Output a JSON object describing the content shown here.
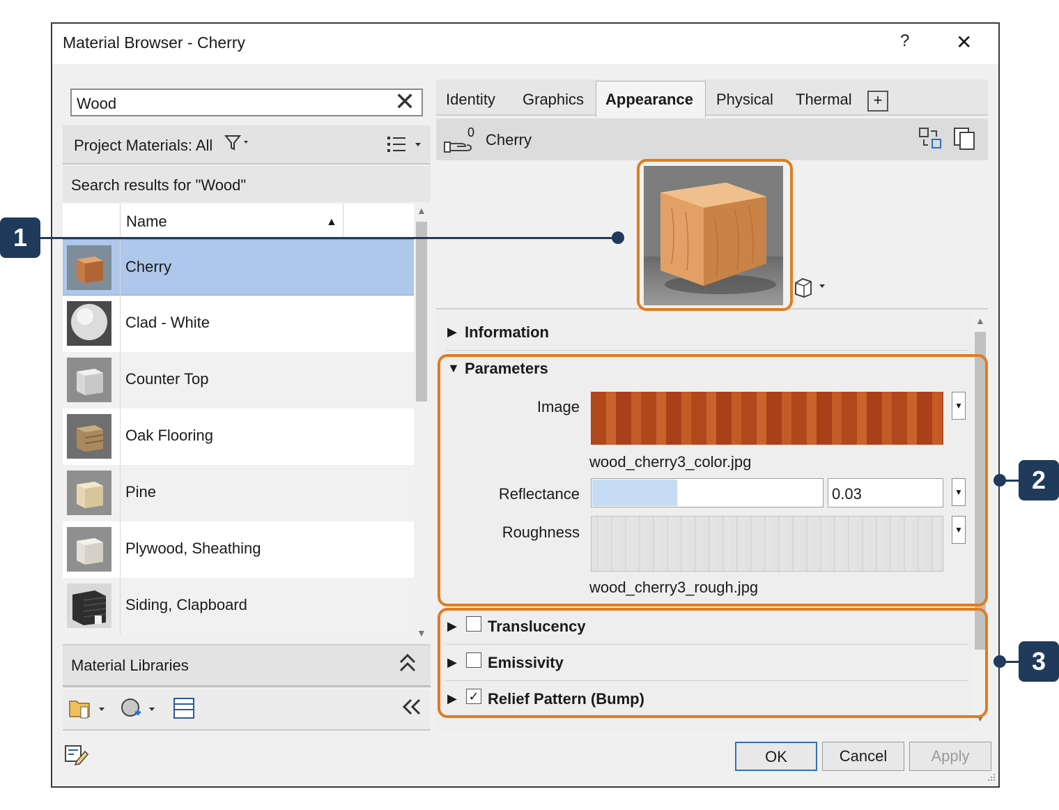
{
  "window": {
    "title": "Material Browser - Cherry",
    "help_label": "?",
    "close_label": "✕"
  },
  "search": {
    "value": "Wood",
    "clear_label": "✕"
  },
  "filter": {
    "label": "Project Materials: All",
    "filter_icon": "filter-icon",
    "view_icon": "list-view-icon"
  },
  "results_label": "Search results for \"Wood\"",
  "list": {
    "header_name": "Name",
    "sort_indicator": "▲",
    "items": [
      {
        "label": "Cherry"
      },
      {
        "label": "Clad - White"
      },
      {
        "label": "Counter Top"
      },
      {
        "label": "Oak Flooring"
      },
      {
        "label": "Pine"
      },
      {
        "label": "Plywood, Sheathing"
      },
      {
        "label": "Siding, Clapboard"
      }
    ]
  },
  "libraries": {
    "label": "Material Libraries",
    "collapse_label": "⌃",
    "hide_label": "«"
  },
  "tabs": [
    {
      "label": "Identity"
    },
    {
      "label": "Graphics"
    },
    {
      "label": "Appearance"
    },
    {
      "label": "Physical"
    },
    {
      "label": "Thermal"
    }
  ],
  "tab_add_label": "+",
  "asset": {
    "count": "0",
    "name": "Cherry"
  },
  "sections": {
    "information": "Information",
    "parameters": "Parameters",
    "translucency": "Translucency",
    "emissivity": "Emissivity",
    "relief": "Relief Pattern (Bump)"
  },
  "parameters": {
    "image_label": "Image",
    "image_file": "wood_cherry3_color.jpg",
    "reflectance_label": "Reflectance",
    "reflectance_value": "0.03",
    "reflectance_fraction": 0.37,
    "roughness_label": "Roughness",
    "roughness_file": "wood_cherry3_rough.jpg"
  },
  "checks": {
    "translucency": false,
    "emissivity": false,
    "relief": true,
    "check_mark": "✓"
  },
  "buttons": {
    "ok": "OK",
    "cancel": "Cancel",
    "apply": "Apply"
  },
  "callouts": [
    "1",
    "2",
    "3"
  ],
  "colors": {
    "highlight": "#e07c1e",
    "callout": "#1f3a5a",
    "selection": "#aec7ea"
  }
}
